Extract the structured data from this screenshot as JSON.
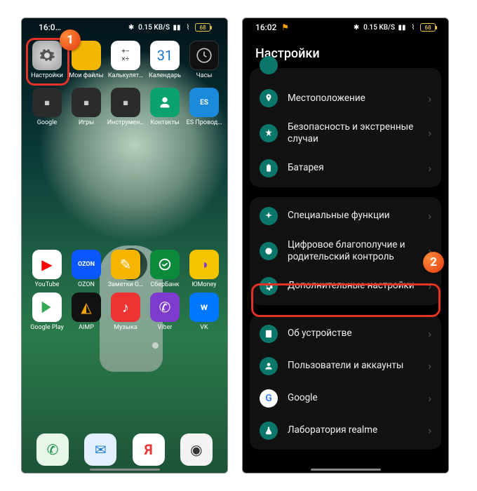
{
  "status": {
    "time_left": "16:0…",
    "time_right": "16:02",
    "net_speed": "0.15 KB/S",
    "battery": "68"
  },
  "callouts": {
    "one": "1",
    "two": "2"
  },
  "home": {
    "row1": [
      {
        "label": "Настройки",
        "icon": "gear"
      },
      {
        "label": "Мои файлы",
        "icon": "files"
      },
      {
        "label": "Калькулят…",
        "icon": "calc"
      },
      {
        "label": "Календарь",
        "icon": "cal"
      },
      {
        "label": "Часы",
        "icon": "clock"
      }
    ],
    "row2": [
      {
        "label": "Google",
        "icon": "folder"
      },
      {
        "label": "Игры",
        "icon": "folder"
      },
      {
        "label": "Инструмен…",
        "icon": "folder"
      },
      {
        "label": "Контакты",
        "icon": "contacts"
      },
      {
        "label": "ES Провод…",
        "icon": "es"
      }
    ],
    "row3": [
      {
        "label": "YouTube",
        "icon": "yt"
      },
      {
        "label": "OZON",
        "icon": "ozon"
      },
      {
        "label": "Заметки G…",
        "icon": "notes"
      },
      {
        "label": "СберБанк",
        "icon": "sber"
      },
      {
        "label": "ЮMoney",
        "icon": "yoom"
      }
    ],
    "row4": [
      {
        "label": "Google Play",
        "icon": "play"
      },
      {
        "label": "AIMP",
        "icon": "aimp"
      },
      {
        "label": "Музыка",
        "icon": "music"
      },
      {
        "label": "Viber",
        "icon": "viber"
      },
      {
        "label": "VK",
        "icon": "vk"
      }
    ],
    "dock": [
      {
        "icon": "phone"
      },
      {
        "icon": "sms"
      },
      {
        "icon": "yandex"
      },
      {
        "icon": "cam"
      }
    ]
  },
  "settings": {
    "title": "Настройки",
    "group1": [
      {
        "label": "Местоположение",
        "icon": "pin"
      },
      {
        "label": "Безопасность и экстренные случаи",
        "icon": "star"
      },
      {
        "label": "Батарея",
        "icon": "battery"
      }
    ],
    "group2": [
      {
        "label": "Специальные функции",
        "icon": "sparkle"
      },
      {
        "label": "Цифровое благополучие и родительский контроль",
        "icon": "wellbeing"
      },
      {
        "label": "Дополнительные настройки",
        "icon": "gear",
        "highlight": true
      }
    ],
    "group3": [
      {
        "label": "Об устройстве",
        "icon": "info"
      },
      {
        "label": "Пользователи и аккаунты",
        "icon": "user"
      },
      {
        "label": "Google",
        "icon": "google"
      },
      {
        "label": "Лаборатория realme",
        "icon": "flask"
      }
    ]
  }
}
